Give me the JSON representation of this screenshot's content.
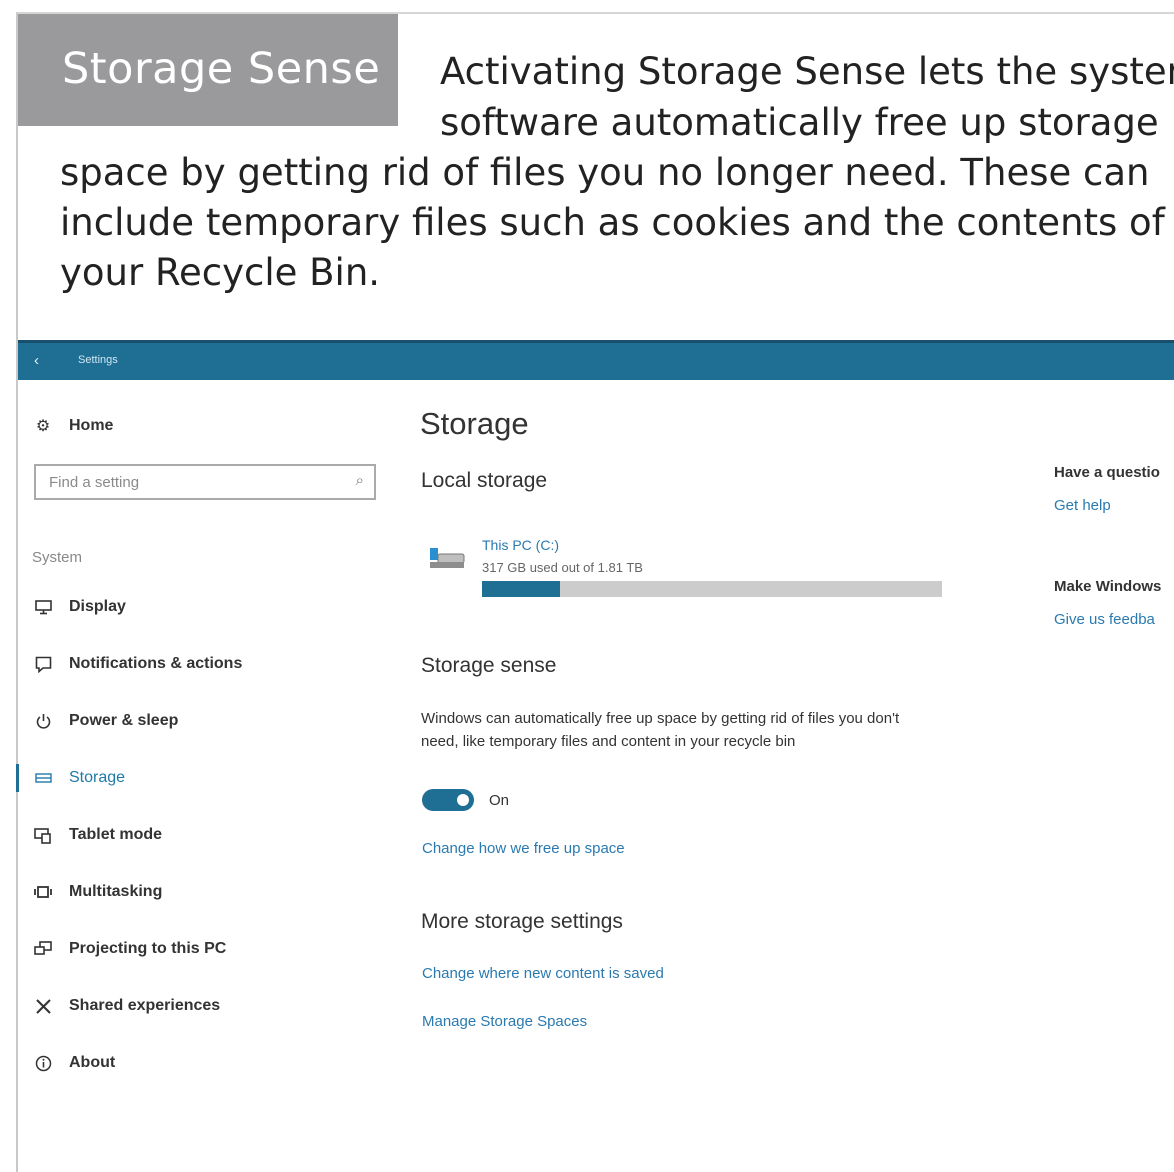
{
  "header": {
    "title": "Storage Sense",
    "intro_lines": [
      "Activating Storage Sense lets the system",
      "software automatically free up storage",
      "space by getting rid of files you no longer need. These can",
      "include temporary files such as cookies and the contents of",
      "your Recycle Bin."
    ]
  },
  "window": {
    "back_glyph": "‹",
    "title": "Settings"
  },
  "sidebar": {
    "home_label": "Home",
    "search_placeholder": "Find a setting",
    "section_label": "System",
    "items": [
      {
        "label": "Display",
        "icon": "display-icon"
      },
      {
        "label": "Notifications & actions",
        "icon": "notifications-icon"
      },
      {
        "label": "Power & sleep",
        "icon": "power-icon"
      },
      {
        "label": "Storage",
        "icon": "storage-icon",
        "active": true
      },
      {
        "label": "Tablet mode",
        "icon": "tablet-mode-icon"
      },
      {
        "label": "Multitasking",
        "icon": "multitasking-icon"
      },
      {
        "label": "Projecting to this PC",
        "icon": "projecting-icon"
      },
      {
        "label": "Shared experiences",
        "icon": "shared-experiences-icon"
      },
      {
        "label": "About",
        "icon": "about-icon"
      }
    ]
  },
  "main": {
    "title": "Storage",
    "local_storage": {
      "heading": "Local storage",
      "drive_name": "This PC (C:)",
      "usage_text": "317 GB used out of 1.81 TB",
      "used_fraction": 0.17
    },
    "storage_sense": {
      "heading": "Storage sense",
      "description": "Windows can automatically free up space by getting rid of files you don't need, like temporary files and content in your recycle bin",
      "toggle_state": "On",
      "change_link": "Change how we free up space"
    },
    "more": {
      "heading": "More storage settings",
      "link1": "Change where new content is saved",
      "link2": "Manage Storage Spaces"
    }
  },
  "aside": {
    "question": "Have a questio",
    "help_link": "Get help",
    "make_better": "Make Windows",
    "feedback_link": "Give us feedba"
  },
  "colors": {
    "accent": "#1f6f94",
    "title_box": "#9a9a9c",
    "link": "#2a7ab0"
  }
}
